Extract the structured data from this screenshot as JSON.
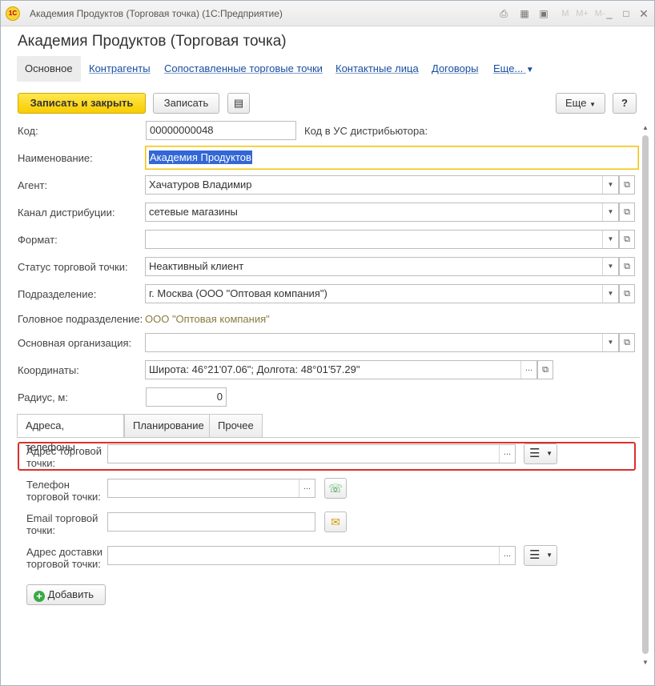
{
  "window": {
    "title": "Академия Продуктов (Торговая точка)  (1С:Предприятие)",
    "logo_text": "1С"
  },
  "form": {
    "title": "Академия Продуктов (Торговая точка)"
  },
  "nav": {
    "main": "Основное",
    "links": [
      "Контрагенты",
      "Сопоставленные торговые точки",
      "Контактные лица",
      "Договоры",
      "Еще..."
    ]
  },
  "commands": {
    "save_close": "Записать и закрыть",
    "save": "Записать",
    "more": "Еще",
    "help": "?"
  },
  "fields": {
    "code_label": "Код:",
    "code_value": "00000000048",
    "distributor_code_label": "Код в УС дистрибьютора:",
    "name_label": "Наименование:",
    "name_value": "Академия Продуктов",
    "agent_label": "Агент:",
    "agent_value": "Хачатуров Владимир",
    "channel_label": "Канал дистрибуции:",
    "channel_value": "сетевые магазины",
    "format_label": "Формат:",
    "format_value": "",
    "status_label": "Статус торговой точки:",
    "status_value": "Неактивный клиент",
    "division_label": "Подразделение:",
    "division_value": "г. Москва  (ООО \"Оптовая компания\")",
    "head_division_label": "Головное подразделение:",
    "head_division_value": "ООО \"Оптовая компания\"",
    "org_label": "Основная организация:",
    "org_value": "",
    "coords_label": "Координаты:",
    "coords_value": "Широта: 46°21'07.06\"; Долгота: 48°01'57.29\"",
    "radius_label": "Радиус, м:",
    "radius_value": "0"
  },
  "tabs": [
    "Адреса, телефоны",
    "Планирование",
    "Прочее"
  ],
  "contacts": {
    "address_label_1": "Адрес торговой",
    "address_label_2": "точки:",
    "phone_label_1": "Телефон",
    "phone_label_2": "торговой точки:",
    "email_label_1": "Email торговой",
    "email_label_2": "точки:",
    "delivery_label_1": "Адрес доставки",
    "delivery_label_2": "торговой точки:",
    "add_button": "Добавить"
  },
  "colors": {
    "primary_button": "#f8cc00",
    "focus_border": "#f1c40f",
    "highlight_border": "#d9312b",
    "link": "#1a4ea0"
  }
}
